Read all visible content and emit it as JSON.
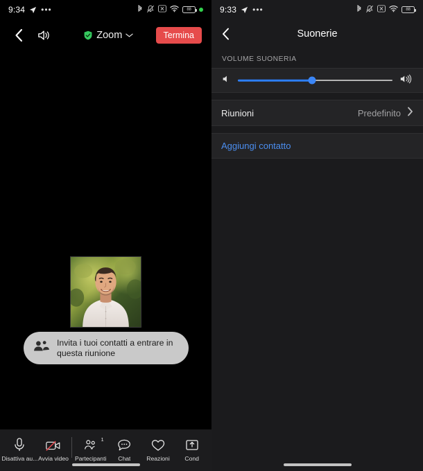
{
  "left_panel": {
    "statusbar": {
      "time": "9:34",
      "location_icon": "location-arrow-icon",
      "more_icon": "ellipsis-icon",
      "icons": [
        "bluetooth-icon",
        "silent-mode-icon",
        "vpn-icon",
        "wifi-icon"
      ],
      "battery_level": "88",
      "recording_dot": "green-status-dot"
    },
    "topbar": {
      "back_icon": "back-chevron-icon",
      "speaker_icon": "speaker-on-icon",
      "shield_icon": "encryption-shield-icon",
      "title": "Zoom",
      "chevron_icon": "chevron-down-icon",
      "end_button": "Termina"
    },
    "stage": {
      "avatar_name": "participant-avatar",
      "tooltip": {
        "icon": "people-group-icon",
        "text": "Invita i tuoi contatti a entrare in questa riunione"
      }
    },
    "toolbar": [
      {
        "icon": "microphone-icon",
        "label": "Disattiva au...",
        "badge": ""
      },
      {
        "icon": "video-off-icon",
        "label": "Avvia video",
        "badge": ""
      },
      {
        "icon": "participants-icon",
        "label": "Partecipanti",
        "badge": "1"
      },
      {
        "icon": "chat-bubble-icon",
        "label": "Chat",
        "badge": ""
      },
      {
        "icon": "heart-icon",
        "label": "Reazioni",
        "badge": ""
      },
      {
        "icon": "share-screen-icon",
        "label": "Cond",
        "badge": ""
      }
    ]
  },
  "right_panel": {
    "statusbar": {
      "time": "9:33",
      "location_icon": "location-arrow-icon",
      "more_icon": "ellipsis-icon",
      "icons": [
        "bluetooth-icon",
        "silent-mode-icon",
        "vpn-icon",
        "wifi-icon"
      ],
      "battery_level": "88"
    },
    "navbar": {
      "back_icon": "back-chevron-icon",
      "title": "Suonerie"
    },
    "volume_section": {
      "label": "VOLUME SUONERIA",
      "min_icon": "speaker-low-icon",
      "max_icon": "speaker-high-icon",
      "value_percent": 48
    },
    "rows": [
      {
        "label": "Riunioni",
        "value": "Predefinito",
        "chevron": "chevron-right-icon"
      }
    ],
    "link": {
      "label": "Aggiungi contatto"
    }
  },
  "colors": {
    "end_button": "#e64b4b",
    "shield_green": "#36c95f",
    "slider_blue": "#2d7ff9",
    "link_blue": "#4b8ef0",
    "row_bg": "#242426",
    "panel_bg": "#1b1b1d"
  }
}
